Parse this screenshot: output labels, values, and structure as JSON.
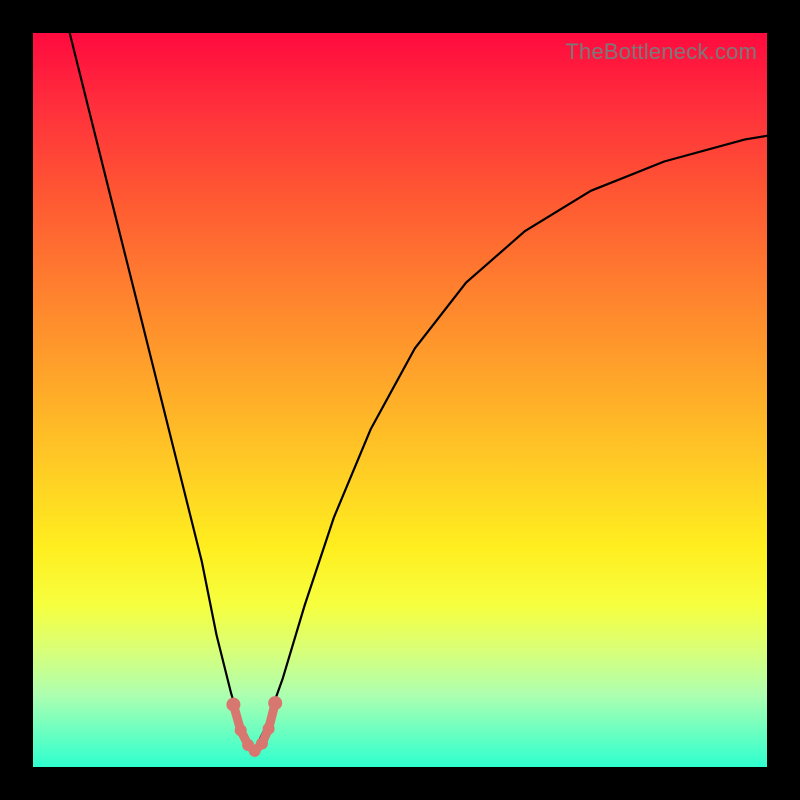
{
  "watermark": "TheBottleneck.com",
  "colors": {
    "background": "#000000",
    "curve": "#000000",
    "marker": "#d87770"
  },
  "chart_data": {
    "type": "line",
    "title": "",
    "xlabel": "",
    "ylabel": "",
    "xlim": [
      0,
      100
    ],
    "ylim": [
      0,
      100
    ],
    "series": [
      {
        "name": "curve",
        "x": [
          5,
          8,
          11,
          14,
          17,
          20,
          23,
          25,
          27,
          28.5,
          30,
          31.5,
          34,
          37,
          41,
          46,
          52,
          59,
          67,
          76,
          86,
          97,
          100
        ],
        "y": [
          100,
          88,
          76,
          64,
          52,
          40,
          28,
          18,
          10,
          5,
          2,
          5,
          12,
          22,
          34,
          46,
          57,
          66,
          73,
          78.5,
          82.5,
          85.5,
          86
        ]
      }
    ],
    "markers": {
      "name": "highlight",
      "x": [
        27.3,
        28.3,
        29.3,
        30.2,
        31.2,
        32.1,
        33.0
      ],
      "y": [
        8.5,
        5.0,
        3.0,
        2.2,
        3.2,
        5.2,
        8.7
      ]
    }
  }
}
